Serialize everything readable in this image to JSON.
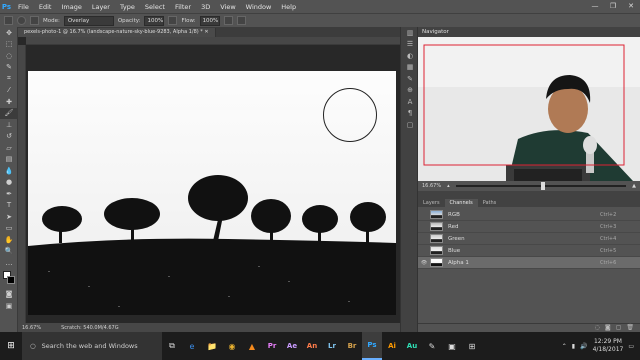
{
  "app": {
    "logo": "Ps"
  },
  "menu": [
    "File",
    "Edit",
    "Image",
    "Layer",
    "Type",
    "Select",
    "Filter",
    "3D",
    "View",
    "Window",
    "Help"
  ],
  "window_controls": [
    "—",
    "❐",
    "✕"
  ],
  "options": {
    "mode_label": "Mode:",
    "mode_value": "Overlay",
    "opacity_label": "Opacity:",
    "opacity_value": "100%",
    "flow_label": "Flow:",
    "flow_value": "100%"
  },
  "document": {
    "tab_title": "pexels-photo-1 @ 16.7% (landscape-nature-sky-blue-9283, Alpha 1/8) *",
    "zoom": "16.67%",
    "scratch": "Scratch: 540.0M/4.67G"
  },
  "navigator": {
    "title": "Navigator",
    "zoom": "16.67%",
    "zoom_fraction": 0.5
  },
  "channels": {
    "tabs": [
      "Layers",
      "Channels",
      "Paths"
    ],
    "active_tab": 1,
    "rows": [
      {
        "name": "RGB",
        "shortcut": "Ctrl+2",
        "visible": false,
        "selected": false
      },
      {
        "name": "Red",
        "shortcut": "Ctrl+3",
        "visible": false,
        "selected": false
      },
      {
        "name": "Green",
        "shortcut": "Ctrl+4",
        "visible": false,
        "selected": false
      },
      {
        "name": "Blue",
        "shortcut": "Ctrl+5",
        "visible": false,
        "selected": false
      },
      {
        "name": "Alpha 1",
        "shortcut": "Ctrl+6",
        "visible": true,
        "selected": true
      }
    ]
  },
  "taskbar": {
    "search_placeholder": "Search the web and Windows",
    "time": "12:29 PM",
    "date": "4/18/2017",
    "apps": [
      "⧉",
      "e",
      "📁",
      "◉",
      "▲",
      "Pr",
      "Ae",
      "An",
      "Lr",
      "Br",
      "Ps",
      "Ai",
      "Au",
      "✎",
      "▣",
      "⊞"
    ]
  },
  "icons": {
    "brush": "brush-icon",
    "eye": "eye-icon",
    "search": "search-icon"
  }
}
